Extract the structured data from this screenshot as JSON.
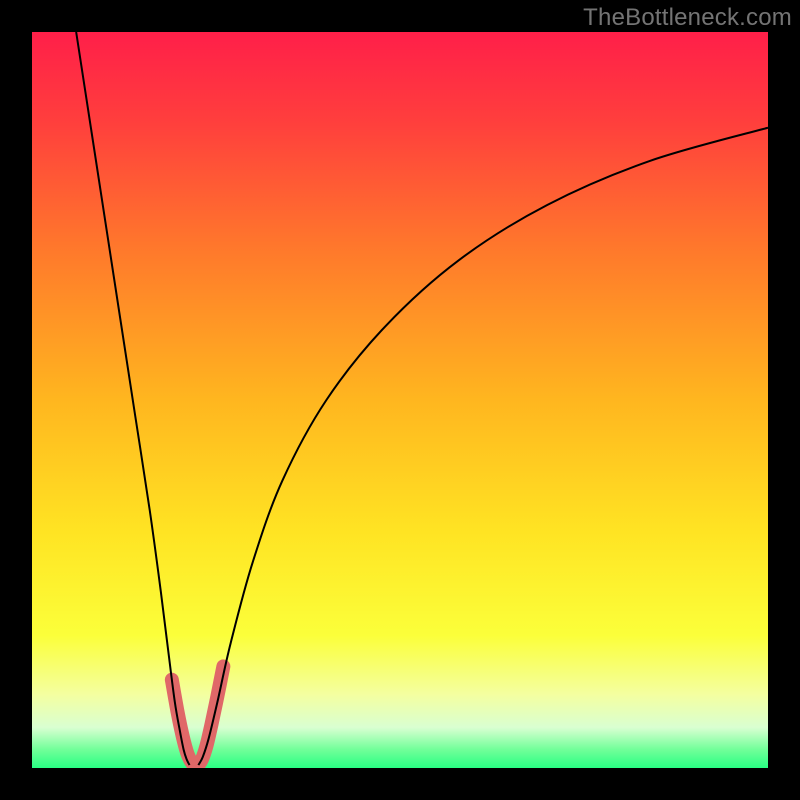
{
  "watermark": "TheBottleneck.com",
  "chart_data": {
    "type": "line",
    "title": "",
    "xlabel": "",
    "ylabel": "",
    "xlim": [
      0,
      100
    ],
    "ylim": [
      0,
      100
    ],
    "grid": false,
    "legend": "none",
    "background_gradient": {
      "stops": [
        {
          "offset": 0.0,
          "color": "#ff1f49"
        },
        {
          "offset": 0.12,
          "color": "#ff3e3d"
        },
        {
          "offset": 0.3,
          "color": "#ff7a2b"
        },
        {
          "offset": 0.5,
          "color": "#ffb61f"
        },
        {
          "offset": 0.68,
          "color": "#ffe423"
        },
        {
          "offset": 0.82,
          "color": "#fbff3a"
        },
        {
          "offset": 0.9,
          "color": "#f4ffa0"
        },
        {
          "offset": 0.945,
          "color": "#d9ffd1"
        },
        {
          "offset": 0.975,
          "color": "#71ff99"
        },
        {
          "offset": 1.0,
          "color": "#29ff83"
        }
      ]
    },
    "series": [
      {
        "name": "left-curve",
        "color": "#000000",
        "linewidth": 2,
        "x": [
          6,
          8,
          10,
          12,
          14,
          16,
          17.5,
          18.5,
          19.4,
          20.1,
          20.6,
          21,
          21.4
        ],
        "y": [
          100,
          87,
          74,
          61,
          48,
          35,
          24,
          16,
          9,
          5,
          2.5,
          1.2,
          0.4
        ]
      },
      {
        "name": "right-curve",
        "color": "#000000",
        "linewidth": 2,
        "x": [
          22.6,
          23.2,
          24,
          25.2,
          27,
          30,
          34,
          40,
          48,
          58,
          70,
          84,
          100
        ],
        "y": [
          0.4,
          1.5,
          4,
          9,
          17,
          28,
          39,
          50,
          60,
          69,
          76.5,
          82.5,
          87
        ]
      }
    ],
    "thick_overlay": {
      "note": "salmon rounded stroke near the minimum",
      "color": "#e06868",
      "linewidth": 14,
      "linecap": "round",
      "segments": [
        {
          "name": "left-bottom",
          "x": [
            19.0,
            19.8,
            20.5,
            21.1,
            21.6,
            22.0
          ],
          "y": [
            12.0,
            7.5,
            4.2,
            2.0,
            0.9,
            0.4
          ]
        },
        {
          "name": "right-bottom",
          "x": [
            22.6,
            23.1,
            23.7,
            24.4,
            25.2,
            26.0
          ],
          "y": [
            0.4,
            1.2,
            3.0,
            6.0,
            9.8,
            13.8
          ]
        }
      ]
    }
  }
}
